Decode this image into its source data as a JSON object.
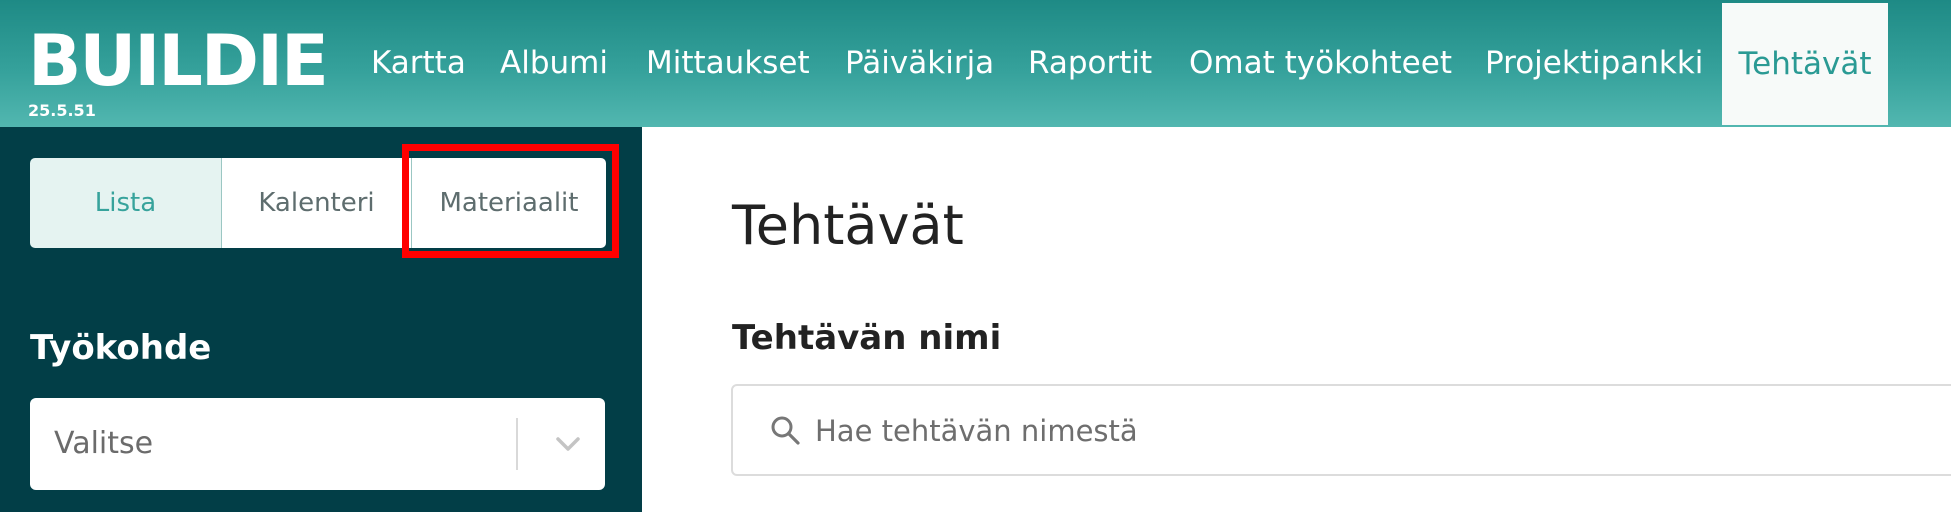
{
  "app": {
    "logo_text": "BUILDIE",
    "version": "25.5.51"
  },
  "nav": {
    "items": [
      {
        "label": "Kartta"
      },
      {
        "label": "Albumi"
      },
      {
        "label": "Mittaukset"
      },
      {
        "label": "Päiväkirja"
      },
      {
        "label": "Raportit"
      },
      {
        "label": "Omat työkohteet"
      },
      {
        "label": "Projektipankki"
      },
      {
        "label": "Tehtävät",
        "active": true
      }
    ]
  },
  "sidebar": {
    "view_tabs": [
      {
        "label": "Lista",
        "active": true
      },
      {
        "label": "Kalenteri"
      },
      {
        "label": "Materiaalit",
        "highlighted": true
      }
    ],
    "worksite_label": "Työkohde",
    "worksite_select": {
      "value": "Valitse",
      "icon": "chevron-down-icon"
    }
  },
  "main": {
    "title": "Tehtävät",
    "task_name_label": "Tehtävän nimi",
    "search": {
      "placeholder": "Hae tehtävän nimestä",
      "value": "",
      "icon": "search-icon"
    }
  },
  "colors": {
    "topbar": "#2a9a94",
    "sidebar": "#023e47",
    "accent": "#37a39c",
    "highlight_box": "#ff0000"
  }
}
